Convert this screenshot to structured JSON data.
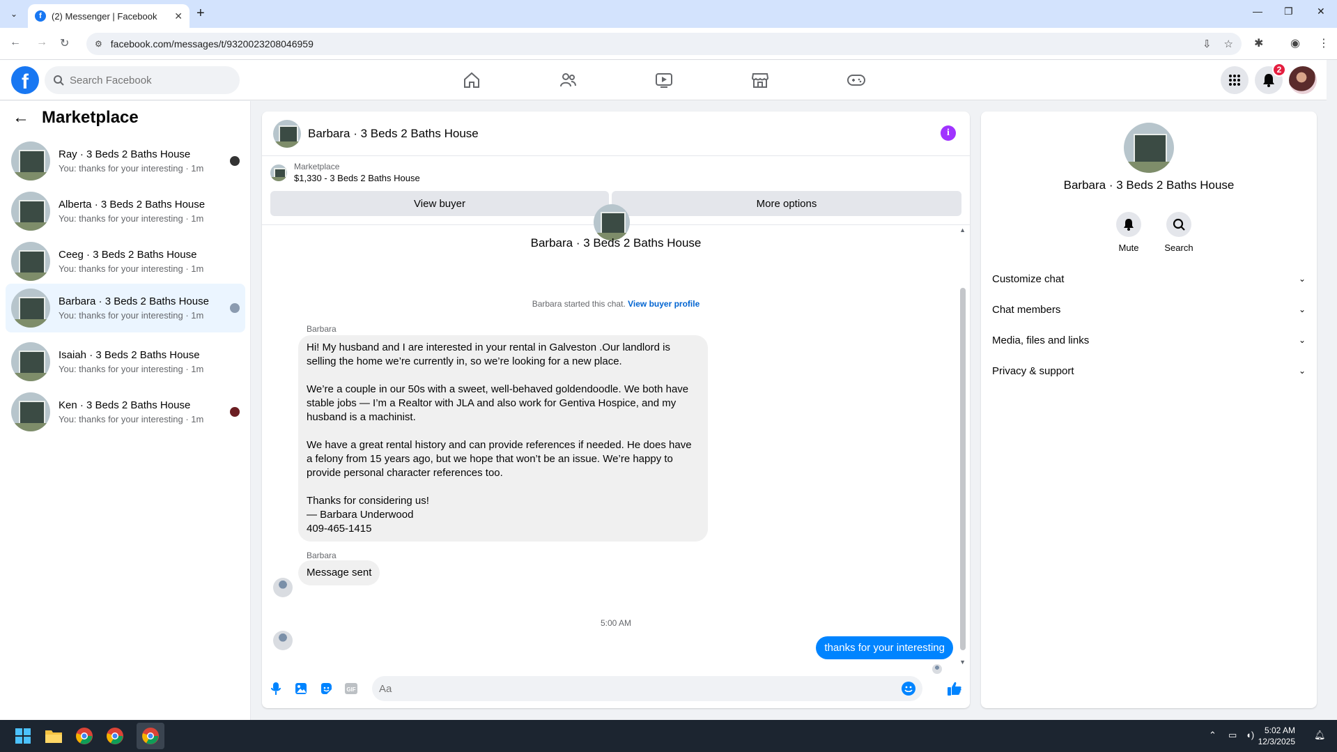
{
  "browser": {
    "tab_title": "(2) Messenger | Facebook",
    "url": "facebook.com/messages/t/9320023208046959"
  },
  "fb": {
    "search_placeholder": "Search Facebook",
    "notification_count": "2",
    "brand_color": "#1877f2"
  },
  "sidebar": {
    "title": "Marketplace",
    "conversations": [
      {
        "name": "Ray · 3 Beds 2 Baths House",
        "preview": "You: thanks for your interesting · 1m"
      },
      {
        "name": "Alberta · 3 Beds 2 Baths House",
        "preview": "You: thanks for your interesting · 1m"
      },
      {
        "name": "Ceeg · 3 Beds 2 Baths House",
        "preview": "You: thanks for your interesting · 1m"
      },
      {
        "name": "Barbara · 3 Beds 2 Baths House",
        "preview": "You: thanks for your interesting · 1m"
      },
      {
        "name": "Isaiah · 3 Beds 2 Baths House",
        "preview": "You: thanks for your interesting · 1m"
      },
      {
        "name": "Ken · 3 Beds 2 Baths House",
        "preview": "You: thanks for your interesting · 1m"
      }
    ]
  },
  "chat": {
    "title": "Barbara · 3 Beds 2 Baths House",
    "marketplace_label": "Marketplace",
    "listing": "$1,330 - 3 Beds 2 Baths House",
    "view_buyer_label": "View buyer",
    "more_options_label": "More options",
    "center_name": "Barbara · 3 Beds 2 Baths House",
    "started_text": "Barbara started this chat.",
    "view_buyer_profile": "View buyer profile",
    "sender_name": "Barbara",
    "message_paragraphs": [
      "Hi! My husband and I are interested in your rental in Galveston .Our landlord is selling the home we’re currently in, so we’re looking for a new place.",
      "We’re a couple in our 50s with a sweet, well-behaved goldendoodle. We both have stable jobs — I’m a Realtor with JLA and also work for Gentiva Hospice, and my husband is a machinist.",
      "We have a great rental history and can provide references if needed. He does have a felony from 15 years ago, but we hope that won’t be an issue. We’re happy to provide personal character references too.",
      "Thanks for considering us!\n— Barbara Underwood\n409-465-1415"
    ],
    "second_message": "Message sent",
    "timestamp": "5:00 AM",
    "outgoing_message": "thanks for your interesting",
    "composer_placeholder": "Aa",
    "accent_color": "#0084ff"
  },
  "details": {
    "name": "Barbara · 3 Beds 2 Baths House",
    "mute_label": "Mute",
    "search_label": "Search",
    "sections": [
      "Customize chat",
      "Chat members",
      "Media, files and links",
      "Privacy & support"
    ]
  },
  "taskbar": {
    "time": "5:02 AM",
    "date": "12/3/2025"
  }
}
